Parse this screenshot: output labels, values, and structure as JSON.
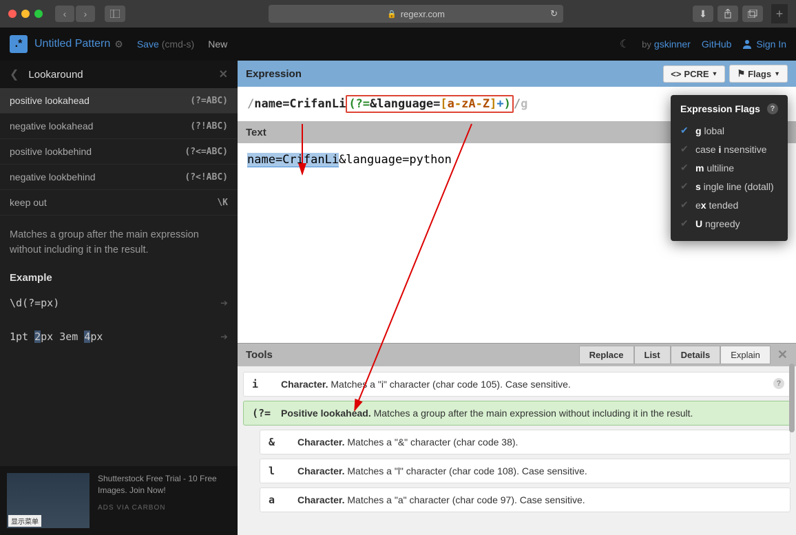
{
  "browser": {
    "url": "regexr.com"
  },
  "header": {
    "pattern_name": "Untitled Pattern",
    "save": "Save",
    "save_hint": "(cmd-s)",
    "new": "New",
    "by": "by",
    "author": "gskinner",
    "github": "GitHub",
    "signin": "Sign In"
  },
  "sidebar": {
    "title": "Lookaround",
    "items": [
      {
        "label": "positive lookahead",
        "code": "(?=ABC)",
        "selected": true
      },
      {
        "label": "negative lookahead",
        "code": "(?!ABC)"
      },
      {
        "label": "positive lookbehind",
        "code": "(?<=ABC)"
      },
      {
        "label": "negative lookbehind",
        "code": "(?<!ABC)"
      },
      {
        "label": "keep out",
        "code": "\\K"
      }
    ],
    "description": "Matches a group after the main expression without including it in the result.",
    "example_heading": "Example",
    "example_code": "\\d(?=px)",
    "example_text_parts": [
      "1pt ",
      "2",
      "px 3em ",
      "4",
      "px"
    ],
    "ad_text": "Shutterstock Free Trial - 10 Free Images. Join Now!",
    "ad_via": "ADS VIA CARBON",
    "ad_badge": "显示菜单"
  },
  "expression": {
    "header": "Expression",
    "engine": "PCRE",
    "flags_label": "Flags",
    "regex_plain": "name=CrifanLi",
    "lookahead_open": "(?=",
    "lookahead_plain": "&language=",
    "charclass": "[a-zA-Z]",
    "quant": "+",
    "lookahead_close": ")",
    "flags": "g"
  },
  "text": {
    "header": "Text",
    "match": "name=CrifanLi",
    "rest": "&language=python"
  },
  "flags_dropdown": {
    "title": "Expression Flags",
    "items": [
      {
        "letter": "g",
        "label": "lobal",
        "active": true
      },
      {
        "letter": "i",
        "label": "nsensitive",
        "prefix": "case "
      },
      {
        "letter": "m",
        "label": "ultiline"
      },
      {
        "letter": "s",
        "label": "ingle line (dotall)"
      },
      {
        "letter": "x",
        "label": "tended",
        "prefix": "e"
      },
      {
        "letter": "U",
        "label": "ngreedy"
      }
    ]
  },
  "tools": {
    "header": "Tools",
    "tabs": [
      "Replace",
      "List",
      "Details",
      "Explain"
    ],
    "active_tab": "Explain",
    "explain": [
      {
        "token": "i",
        "title": "Character.",
        "desc": " Matches a \"i\" character (char code 105). Case sensitive.",
        "help": true
      },
      {
        "token": "(?=",
        "title": "Positive lookahead.",
        "desc": " Matches a group after the main expression without including it in the result.",
        "green": true
      },
      {
        "token": "&",
        "title": "Character.",
        "desc": " Matches a \"&\" character (char code 38).",
        "nested": true
      },
      {
        "token": "l",
        "title": "Character.",
        "desc": " Matches a \"l\" character (char code 108). Case sensitive.",
        "nested": true
      },
      {
        "token": "a",
        "title": "Character.",
        "desc": " Matches a \"a\" character (char code 97). Case sensitive.",
        "nested": true
      }
    ]
  }
}
